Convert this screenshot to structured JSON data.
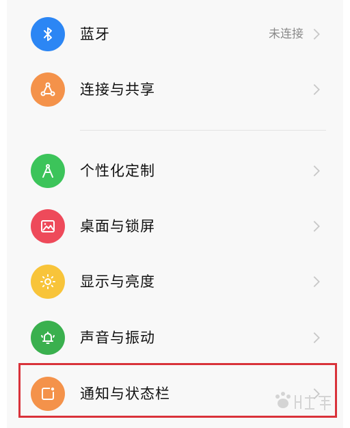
{
  "settings": {
    "items": [
      {
        "label": "蓝牙",
        "status": "未连接",
        "icon": "bluetooth-icon",
        "color": "#2c86f4"
      },
      {
        "label": "连接与共享",
        "status": "",
        "icon": "share-nodes-icon",
        "color": "#f4924a"
      },
      {
        "label": "个性化定制",
        "status": "",
        "icon": "compass-icon",
        "color": "#3cc45a"
      },
      {
        "label": "桌面与锁屏",
        "status": "",
        "icon": "image-icon",
        "color": "#ee4a5a"
      },
      {
        "label": "显示与亮度",
        "status": "",
        "icon": "sun-icon",
        "color": "#f8c43a"
      },
      {
        "label": "声音与振动",
        "status": "",
        "icon": "bell-icon",
        "color": "#3ab04e"
      },
      {
        "label": "通知与状态栏",
        "status": "",
        "icon": "notification-icon",
        "color": "#f4924a"
      }
    ]
  },
  "highlight": {
    "color": "#d9323a",
    "target": "通知与状态栏"
  }
}
